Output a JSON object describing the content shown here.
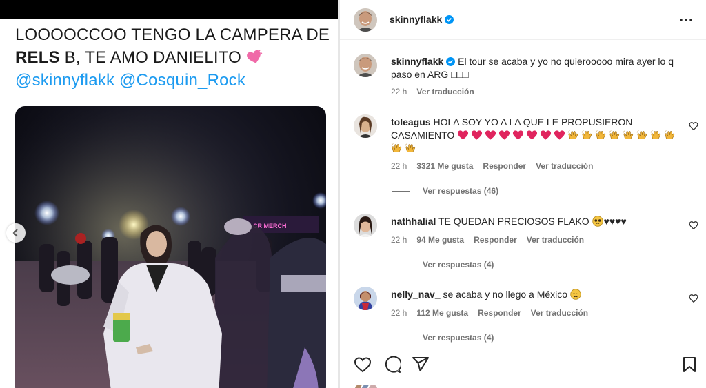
{
  "tweet": {
    "line1": "LOOOOCCOO TENGO LA CAMPERA DE",
    "line2_bold": "RELS",
    "line2_rest": " B, TE AMO DANIELITO ",
    "mention1": "@skinnyflakk",
    "mention2": "@Cosquin_Rock",
    "photo_sign": "CR MERCH"
  },
  "header": {
    "username": "skinnyflakk"
  },
  "caption": {
    "username": "skinnyflakk",
    "text": "El tour se acaba y yo no quierooooo mira ayer lo q paso en ARG □□□",
    "time": "22 h",
    "translate": "Ver traducción"
  },
  "comments": [
    {
      "username": "toleagus",
      "text": "HOLA SOY YO A LA QUE LE PROPUSIERON CASAMIENTO",
      "hearts": 8,
      "clapping_hands": 10,
      "time": "22 h",
      "likes": "3321 Me gusta",
      "reply": "Responder",
      "translate": "Ver traducción",
      "replies": "Ver respuestas (46)"
    },
    {
      "username": "nathhalial",
      "text": "TE QUEDAN PRECIOSOS FLAKO",
      "suffix": "♥♥♥♥",
      "time": "22 h",
      "likes": "94 Me gusta",
      "reply": "Responder",
      "translate": "Ver traducción",
      "replies": "Ver respuestas (4)"
    },
    {
      "username": "nelly_nav_",
      "text": "se acaba y no llego a México",
      "time": "22 h",
      "likes": "112 Me gusta",
      "reply": "Responder",
      "translate": "Ver traducción",
      "replies": "Ver respuestas (4)"
    }
  ],
  "icons": [
    "chevron-left-icon",
    "verified-badge-icon",
    "more-options-icon",
    "like-icon",
    "comment-icon",
    "share-icon",
    "bookmark-icon"
  ],
  "colors": {
    "verified": "#0095f6",
    "mention": "#1d9bf0",
    "heart": "#e0245e",
    "muted": "#737373"
  }
}
